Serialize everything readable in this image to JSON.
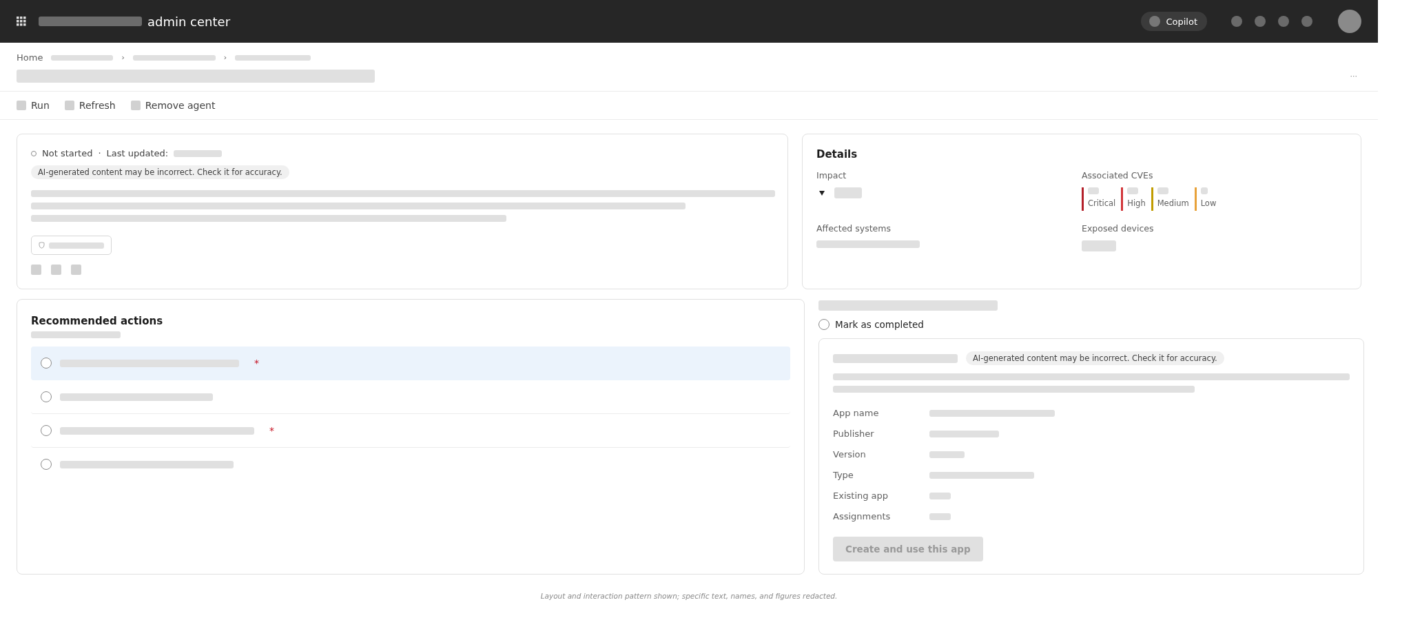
{
  "header": {
    "title": "admin center",
    "copilot": "Copilot"
  },
  "breadcrumb": {
    "home": "Home",
    "separators": [
      "›",
      "›"
    ]
  },
  "page_more": "···",
  "toolbar": [
    {
      "label": "Run"
    },
    {
      "label": "Refresh"
    },
    {
      "label": "Remove agent"
    }
  ],
  "status_card": {
    "status": "Not started",
    "separator": "·",
    "last_updated": "Last updated:",
    "ai_notice": "AI-generated content may be incorrect. Check it for accuracy."
  },
  "details": {
    "title": "Details",
    "impact_label": "Impact",
    "impact_expanded": true,
    "cves_label": "Associated CVEs",
    "affected_label": "Affected systems",
    "exposed_label": "Exposed devices",
    "severities": [
      {
        "label": "Critical",
        "color": "#b4202a"
      },
      {
        "label": "High",
        "color": "#d13438"
      },
      {
        "label": "Medium",
        "color": "#c19c00"
      },
      {
        "label": "Low",
        "color": "#e8a23a"
      }
    ]
  },
  "recommended": {
    "title": "Recommended actions",
    "actions": [
      {
        "selected": true,
        "checked": false,
        "marker": "*"
      },
      {
        "selected": false,
        "checked": false
      },
      {
        "selected": false,
        "checked": false,
        "marker": "*"
      },
      {
        "selected": false,
        "checked": false
      }
    ]
  },
  "action_detail": {
    "mark_completed": {
      "label": "Mark as completed",
      "checked": false
    },
    "ai_notice": "AI-generated content may be incorrect. Check it for accuracy.",
    "fields": [
      {
        "label": "App name"
      },
      {
        "label": "Publisher"
      },
      {
        "label": "Version"
      },
      {
        "label": "Type"
      },
      {
        "label": "Existing app"
      },
      {
        "label": "Assignments"
      }
    ],
    "button": {
      "label": "Create and use this app",
      "disabled": true
    }
  },
  "footer": "Layout and interaction pattern shown; specific text, names, and figures redacted."
}
